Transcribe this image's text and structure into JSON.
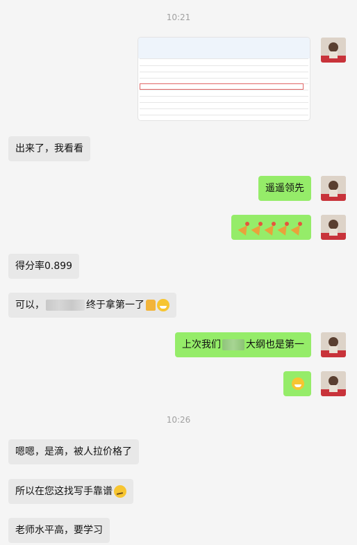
{
  "timestamps": [
    "10:21",
    "10:26"
  ],
  "messages": [
    {
      "side": "out",
      "type": "image"
    },
    {
      "side": "in",
      "text": "出来了，我看看"
    },
    {
      "side": "out",
      "text": "遥遥领先"
    },
    {
      "side": "out",
      "type": "emoji",
      "emoji": "party-popper-icon ×5"
    },
    {
      "side": "in",
      "text": "得分率0.899"
    },
    {
      "side": "in",
      "text_before": "可以，",
      "text_after": "终于拿第一了"
    },
    {
      "side": "out",
      "text_before": "上次我们",
      "text_after": "大纲也是第一"
    },
    {
      "side": "out",
      "type": "emoji",
      "emoji": "grinning-face-icon"
    },
    {
      "side": "in",
      "text": "嗯嗯，是滴，被人拉价格了"
    },
    {
      "side": "in",
      "text": "所以在您这找写手靠谱"
    },
    {
      "side": "in",
      "text": "老师水平高，要学习"
    }
  ],
  "colors": {
    "background": "#f5f5f5",
    "incoming": "#e8e8e8",
    "outgoing": "#95ec69",
    "highlight": "#e06666"
  }
}
